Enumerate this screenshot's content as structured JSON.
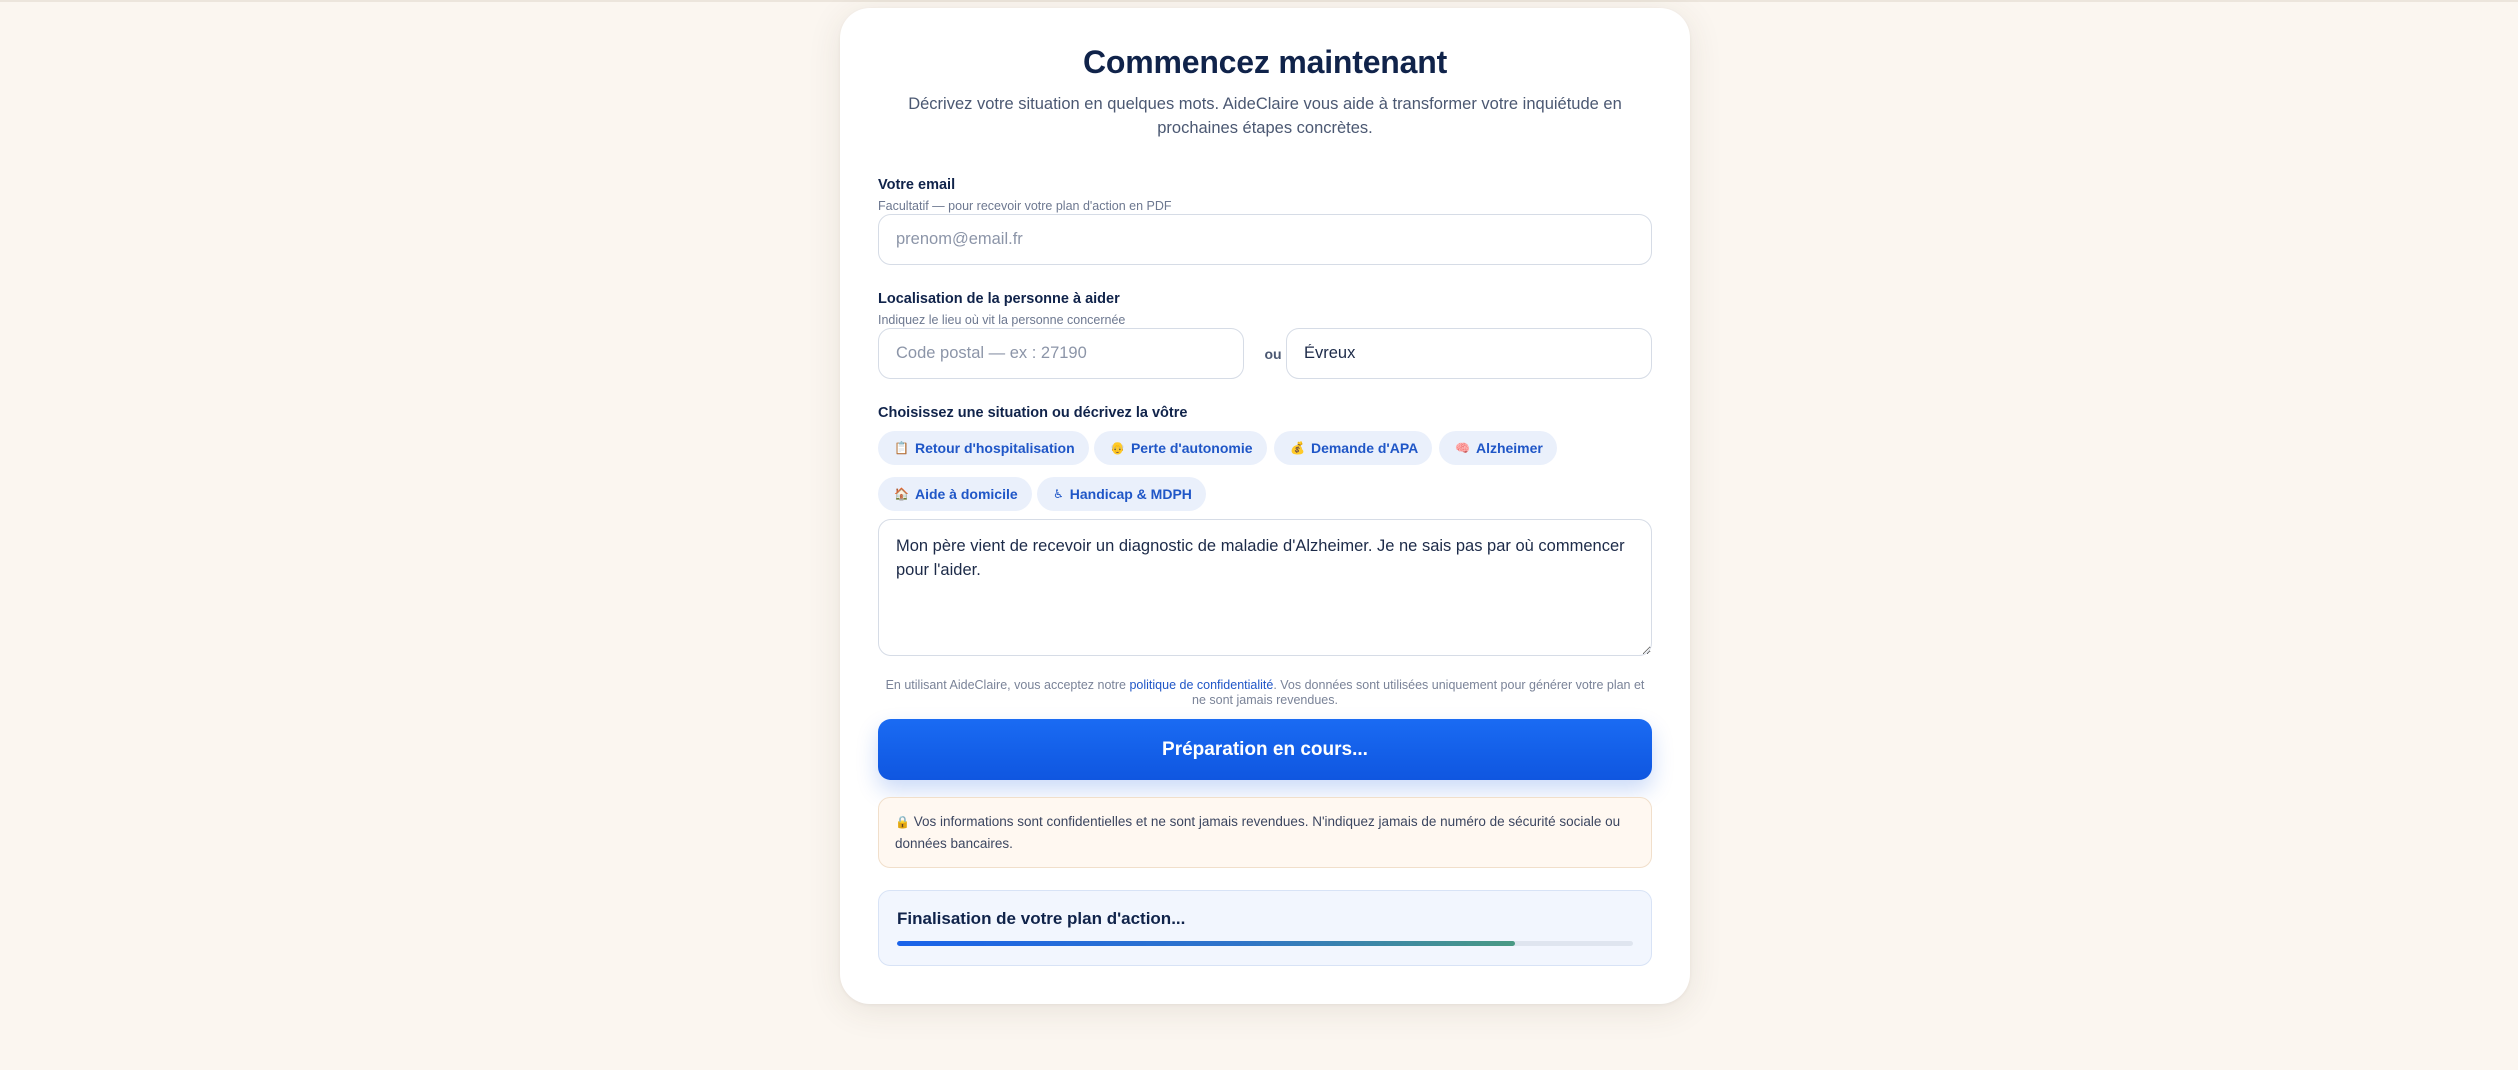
{
  "form": {
    "title": "Commencez maintenant",
    "subtitle": "Décrivez votre situation en quelques mots. AideClaire vous aide à transformer votre inquiétude en prochaines étapes concrètes."
  },
  "email": {
    "label": "Votre email",
    "hint": "Facultatif — pour recevoir votre plan d'action en PDF",
    "placeholder": "prenom@email.fr",
    "value": ""
  },
  "location": {
    "label": "Localisation de la personne à aider",
    "hint": "Indiquez le lieu où vit la personne concernée",
    "postal_placeholder": "Code postal — ex : 27190",
    "postal_value": "",
    "separator": "ou",
    "city_value": "Évreux"
  },
  "situations": {
    "label": "Choisissez une situation ou décrivez la vôtre",
    "chips": [
      {
        "icon": "clipboard-icon",
        "glyph": "📋",
        "label": "Retour d'hospitalisation"
      },
      {
        "icon": "elderly-person-icon",
        "glyph": "👴",
        "label": "Perte d'autonomie"
      },
      {
        "icon": "money-bag-icon",
        "glyph": "💰",
        "label": "Demande d'APA"
      },
      {
        "icon": "brain-icon",
        "glyph": "🧠",
        "label": "Alzheimer"
      },
      {
        "icon": "house-icon",
        "glyph": "🏠",
        "label": "Aide à domicile"
      },
      {
        "icon": "accessibility-icon",
        "glyph": "♿",
        "label": "Handicap & MDPH"
      }
    ]
  },
  "description": {
    "value": "Mon père vient de recevoir un diagnostic de maladie d'Alzheimer. Je ne sais pas par où commencer pour l'aider."
  },
  "privacy": {
    "prefix": "En utilisant AideClaire, vous acceptez notre ",
    "link": "politique de confidentialité",
    "suffix": ". Vos données sont utilisées uniquement pour générer votre plan et ne sont jamais revendues."
  },
  "submit": {
    "label": "Préparation en cours..."
  },
  "notice": {
    "icon": "lock-icon",
    "glyph": "🔒",
    "text": "Vos informations sont confidentielles et ne sont jamais revendues. N'indiquez jamais de numéro de sécurité sociale ou données bancaires."
  },
  "progress": {
    "title": "Finalisation de votre plan d'action...",
    "percent": 84
  },
  "colors": {
    "accent": "#1a6bf3",
    "background": "#fbf6f0",
    "heading": "#10234a",
    "chip_background": "#eaf0fb",
    "chip_text": "#1f56c7"
  }
}
